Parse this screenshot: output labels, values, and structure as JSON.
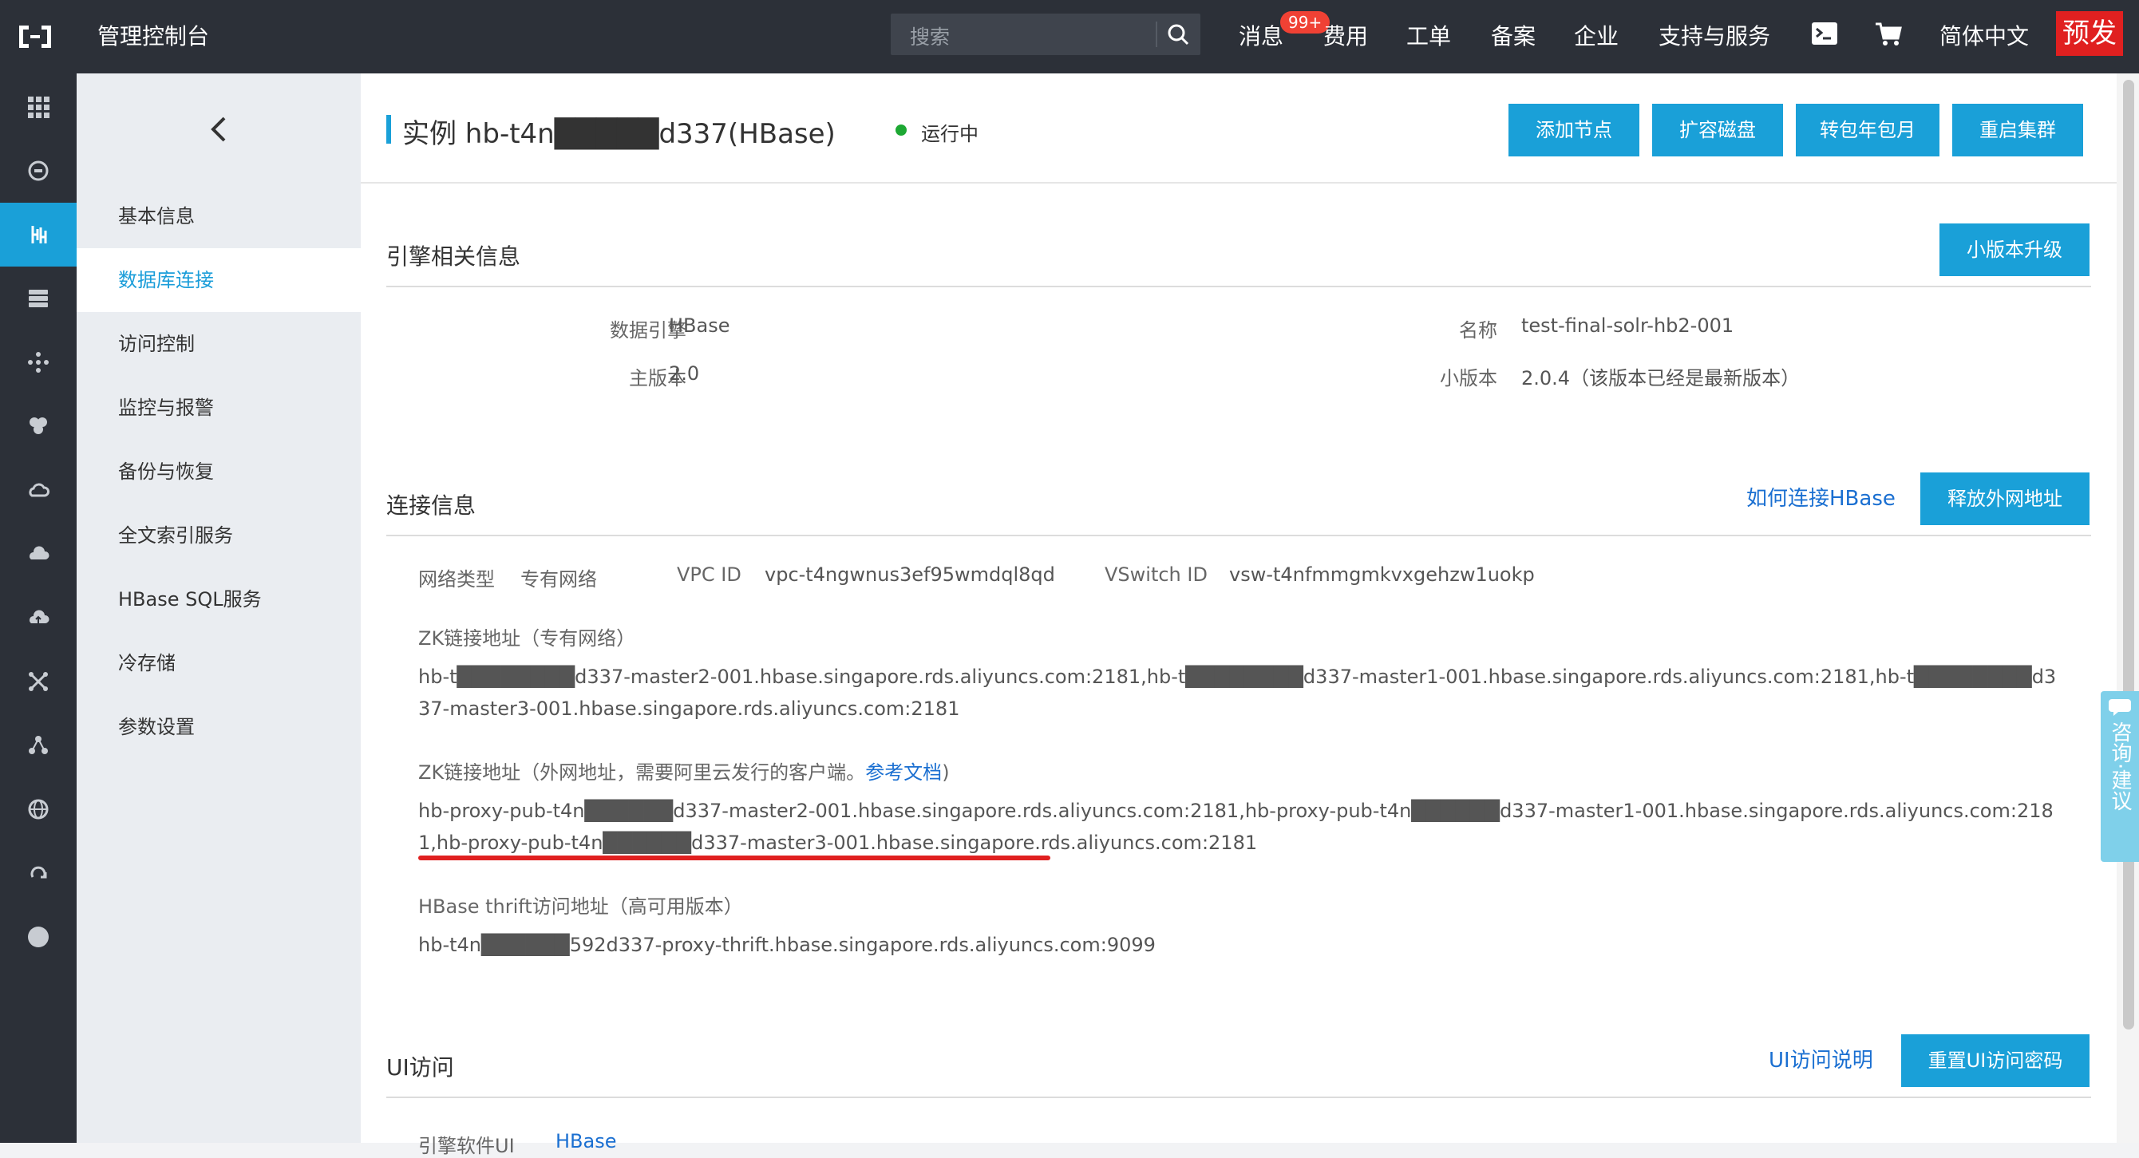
{
  "topbar": {
    "console_title": "管理控制台",
    "search_placeholder": "搜索",
    "messages": "消息",
    "messages_badge": "99+",
    "fees": "费用",
    "tickets": "工单",
    "icp": "备案",
    "enterprise": "企业",
    "support": "支持与服务",
    "language": "简体中文",
    "prerelease": "预发"
  },
  "sidebar": {
    "items": [
      {
        "label": "基本信息"
      },
      {
        "label": "数据库连接"
      },
      {
        "label": "访问控制"
      },
      {
        "label": "监控与报警"
      },
      {
        "label": "备份与恢复"
      },
      {
        "label": "全文索引服务"
      },
      {
        "label": "HBase SQL服务"
      },
      {
        "label": "冷存储"
      },
      {
        "label": "参数设置"
      }
    ]
  },
  "header": {
    "title": "实例 hb-t4n█████d337(HBase)",
    "status": "运行中",
    "buttons": [
      "添加节点",
      "扩容磁盘",
      "转包年包月",
      "重启集群"
    ]
  },
  "engine": {
    "title": "引擎相关信息",
    "upgrade_button": "小版本升级",
    "engine_label": "数据引擎",
    "engine_value": "HBase",
    "major_label": "主版本",
    "major_value": "2.0",
    "name_label": "名称",
    "name_value": "test-final-solr-hb2-001",
    "minor_label": "小版本",
    "minor_value": "2.0.4（该版本已经是最新版本）"
  },
  "connection": {
    "title": "连接信息",
    "how_link": "如何连接HBase",
    "release_button": "释放外网地址",
    "network_type_label": "网络类型",
    "network_type_value": "专有网络",
    "vpc_label": "VPC ID",
    "vpc_value": "vpc-t4ngwnus3ef95wmdql8qd",
    "vswitch_label": "VSwitch ID",
    "vswitch_value": "vsw-t4nfmmgmkvxgehzw1uokp",
    "zk_private_title": "ZK链接地址（专有网络）",
    "zk_private_value": "hb-t████████d337-master2-001.hbase.singapore.rds.aliyuncs.com:2181,hb-t████████d337-master1-001.hbase.singapore.rds.aliyuncs.com:2181,hb-t████████d337-master3-001.hbase.singapore.rds.aliyuncs.com:2181",
    "zk_public_title": "ZK链接地址（外网地址，需要阿里云发行的客户端。",
    "zk_public_doc_link": "参考文档",
    "zk_public_title_end": ")",
    "zk_public_value": "hb-proxy-pub-t4n██████d337-master2-001.hbase.singapore.rds.aliyuncs.com:2181,hb-proxy-pub-t4n██████d337-master1-001.hbase.singapore.rds.aliyuncs.com:2181,hb-proxy-pub-t4n██████d337-master3-001.hbase.singapore.rds.aliyuncs.com:2181",
    "thrift_title": "HBase thrift访问地址（高可用版本）",
    "thrift_value": "hb-t4n██████592d337-proxy-thrift.hbase.singapore.rds.aliyuncs.com:9099"
  },
  "ui_access": {
    "title": "UI访问",
    "help_link": "UI访问说明",
    "reset_button": "重置UI访问密码",
    "engine_ui_label": "引擎软件UI",
    "engine_ui_link": "HBase"
  },
  "consult": "咨询·建议"
}
